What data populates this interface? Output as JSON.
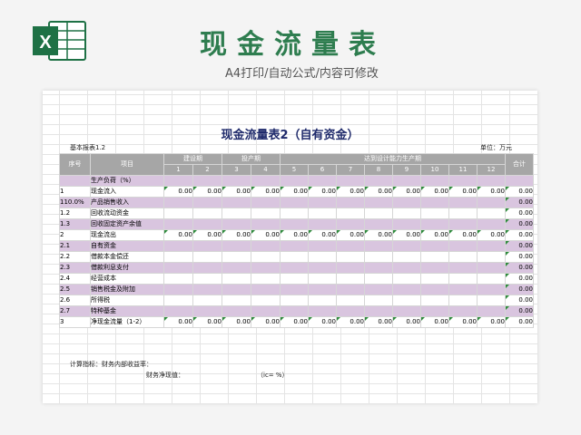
{
  "header": {
    "title": "现金流量表",
    "subtitle": "A4打印/自动公式/内容可修改",
    "logo_letter": "X"
  },
  "sheet": {
    "title": "现金流量表2（自有资金）",
    "table_no": "基本报表1.2",
    "unit": "单位：万元",
    "col_headers": {
      "seq": "序号",
      "item": "项目",
      "construction": "建设期",
      "commissioning": "投产期",
      "production": "达到设计能力生产期",
      "total": "合计",
      "periods": [
        "1",
        "2",
        "3",
        "4",
        "5",
        "6",
        "7",
        "8",
        "9",
        "10",
        "11",
        "12"
      ]
    },
    "rows": [
      {
        "no": "",
        "item": "生产负荷（%）",
        "vals": [
          "",
          "",
          "",
          "",
          "",
          "",
          "",
          "",
          "",
          "",
          "",
          ""
        ],
        "total": "",
        "style": "pur"
      },
      {
        "no": "1",
        "item": "现金流入",
        "vals": [
          "0.00",
          "0.00",
          "0.00",
          "0.00",
          "0.00",
          "0.00",
          "0.00",
          "0.00",
          "0.00",
          "0.00",
          "0.00",
          "0.00"
        ],
        "total": "0.00",
        "style": "wht"
      },
      {
        "no": "110.0%",
        "item": "产品销售收入",
        "vals": [
          "",
          "",
          "",
          "",
          "",
          "",
          "",
          "",
          "",
          "",
          "",
          ""
        ],
        "total": "0.00",
        "style": "pur"
      },
      {
        "no": "1.2",
        "item": "回收流动资金",
        "vals": [
          "",
          "",
          "",
          "",
          "",
          "",
          "",
          "",
          "",
          "",
          "",
          ""
        ],
        "total": "0.00",
        "style": "wht"
      },
      {
        "no": "1.3",
        "item": "回收固定资产余值",
        "vals": [
          "",
          "",
          "",
          "",
          "",
          "",
          "",
          "",
          "",
          "",
          "",
          ""
        ],
        "total": "0.00",
        "style": "pur"
      },
      {
        "no": "2",
        "item": "现金流出",
        "vals": [
          "0.00",
          "0.00",
          "0.00",
          "0.00",
          "0.00",
          "0.00",
          "0.00",
          "0.00",
          "0.00",
          "0.00",
          "0.00",
          "0.00"
        ],
        "total": "0.00",
        "style": "wht"
      },
      {
        "no": "2.1",
        "item": "自有资金",
        "vals": [
          "",
          "",
          "",
          "",
          "",
          "",
          "",
          "",
          "",
          "",
          "",
          ""
        ],
        "total": "0.00",
        "style": "pur"
      },
      {
        "no": "2.2",
        "item": "借款本金偿还",
        "vals": [
          "",
          "",
          "",
          "",
          "",
          "",
          "",
          "",
          "",
          "",
          "",
          ""
        ],
        "total": "0.00",
        "style": "wht"
      },
      {
        "no": "2.3",
        "item": "借款利息支付",
        "vals": [
          "",
          "",
          "",
          "",
          "",
          "",
          "",
          "",
          "",
          "",
          "",
          ""
        ],
        "total": "0.00",
        "style": "pur"
      },
      {
        "no": "2.4",
        "item": "经营成本",
        "vals": [
          "",
          "",
          "",
          "",
          "",
          "",
          "",
          "",
          "",
          "",
          "",
          ""
        ],
        "total": "0.00",
        "style": "wht"
      },
      {
        "no": "2.5",
        "item": "销售税金及附加",
        "vals": [
          "",
          "",
          "",
          "",
          "",
          "",
          "",
          "",
          "",
          "",
          "",
          ""
        ],
        "total": "0.00",
        "style": "pur"
      },
      {
        "no": "2.6",
        "item": "所得税",
        "vals": [
          "",
          "",
          "",
          "",
          "",
          "",
          "",
          "",
          "",
          "",
          "",
          ""
        ],
        "total": "0.00",
        "style": "wht"
      },
      {
        "no": "2.7",
        "item": "特种基金",
        "vals": [
          "",
          "",
          "",
          "",
          "",
          "",
          "",
          "",
          "",
          "",
          "",
          ""
        ],
        "total": "0.00",
        "style": "pur"
      },
      {
        "no": "3",
        "item": "净现金流量（1-2）",
        "vals": [
          "0.00",
          "0.00",
          "0.00",
          "0.00",
          "0.00",
          "0.00",
          "0.00",
          "0.00",
          "0.00",
          "0.00",
          "0.00",
          "0.00"
        ],
        "total": "0.00",
        "style": "wht"
      }
    ],
    "footer": {
      "line1": "计算指标：财务内部收益率：",
      "line2": "财务净现值：",
      "ic": "（ic=  %）"
    }
  },
  "colors": {
    "title_green": "#2e7d4f",
    "header_gray": "#a6a6a6",
    "row_purple": "#d9c5df",
    "excel_green": "#1e7145"
  }
}
